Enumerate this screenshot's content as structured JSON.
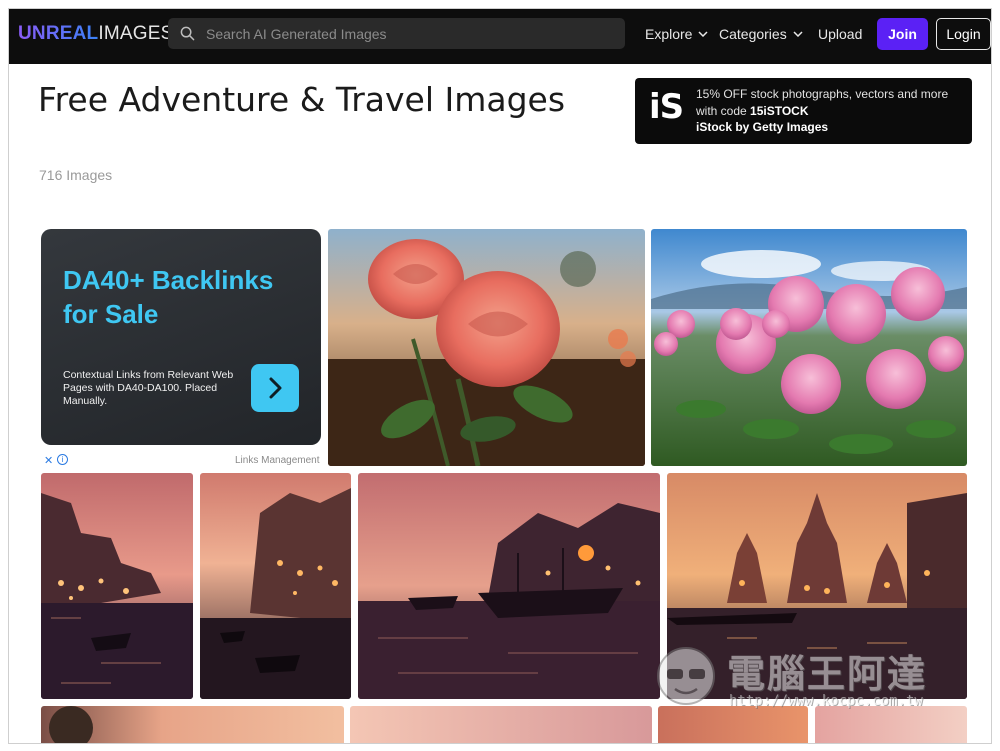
{
  "nav": {
    "logo_primary": "UNREAL",
    "logo_secondary": "IMAGES",
    "search_placeholder": "Search AI Generated Images",
    "explore": "Explore",
    "categories": "Categories",
    "upload": "Upload",
    "join": "Join",
    "login": "Login"
  },
  "page": {
    "title": "Free Adventure & Travel Images",
    "count": "716 Images"
  },
  "istock_ad": {
    "logo": "iS",
    "line1": "15% OFF stock photographs, vectors and more with code",
    "code": "15iSTOCK",
    "line2": "iStock by Getty Images"
  },
  "backlinks_ad": {
    "headline": "DA40+ Backlinks for Sale",
    "description": "Contextual Links from Relevant Web Pages with DA40-DA100. Placed Manually.",
    "close": "✕",
    "info": "i",
    "sponsor": "Links Management"
  },
  "images": [
    {
      "subject": "pink-rose"
    },
    {
      "subject": "pink-clover-flowers"
    },
    {
      "subject": "varanasi-ghats-dusk-1"
    },
    {
      "subject": "varanasi-ghats-dusk-2"
    },
    {
      "subject": "river-boats-dusk"
    },
    {
      "subject": "temple-river-sunset"
    },
    {
      "subject": "row3-partial-1"
    },
    {
      "subject": "row3-partial-2"
    },
    {
      "subject": "row3-partial-3"
    },
    {
      "subject": "row3-partial-4"
    }
  ],
  "watermark": {
    "text": "電腦王阿達",
    "url": "http://www.kocpc.com.tw"
  },
  "colors": {
    "nav_bg": "#0d0d0d",
    "join_bg": "#5b21f5",
    "ad_accent": "#3fc7f2"
  }
}
